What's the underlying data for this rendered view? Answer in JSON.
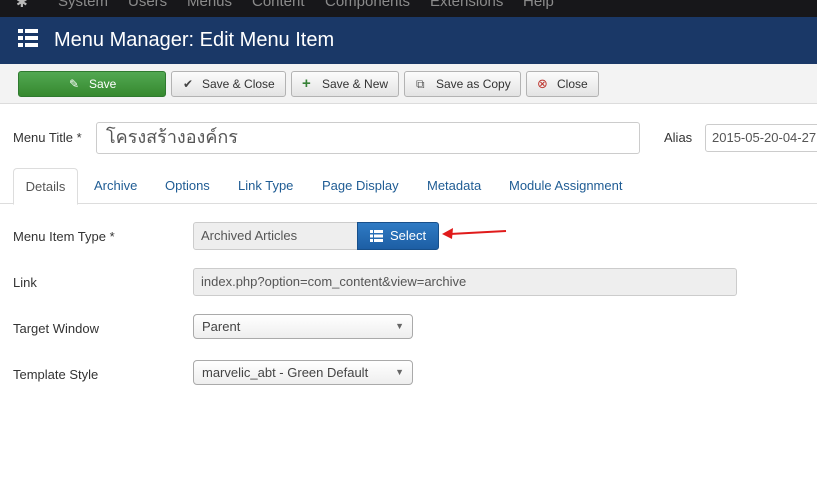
{
  "topnav": {
    "items": [
      "System",
      "Users",
      "Menus",
      "Content",
      "Components",
      "Extensions",
      "Help"
    ]
  },
  "header": {
    "title": "Menu Manager: Edit Menu Item",
    "icon": "list-icon"
  },
  "toolbar": {
    "save": "Save",
    "save_close": "Save & Close",
    "save_new": "Save & New",
    "save_copy": "Save as Copy",
    "close": "Close"
  },
  "form": {
    "menu_title_label": "Menu Title *",
    "menu_title_value": "โครงสร้างองค์กร",
    "alias_label": "Alias",
    "alias_value": "2015-05-20-04-27"
  },
  "tabs": [
    "Details",
    "Archive",
    "Options",
    "Link Type",
    "Page Display",
    "Metadata",
    "Module Assignment"
  ],
  "details": {
    "menu_item_type_label": "Menu Item Type *",
    "menu_item_type_value": "Archived Articles",
    "select_button": "Select",
    "link_label": "Link",
    "link_value": "index.php?option=com_content&view=archive",
    "target_window_label": "Target Window",
    "target_window_value": "Parent",
    "template_style_label": "Template Style",
    "template_style_value": "marvelic_abt - Green Default"
  },
  "colors": {
    "title_bar": "#1a3867",
    "save_green": "#3d9a3d",
    "select_blue": "#2468b0",
    "link_blue": "#1f5c94",
    "annotation_arrow": "#e01b1b"
  }
}
